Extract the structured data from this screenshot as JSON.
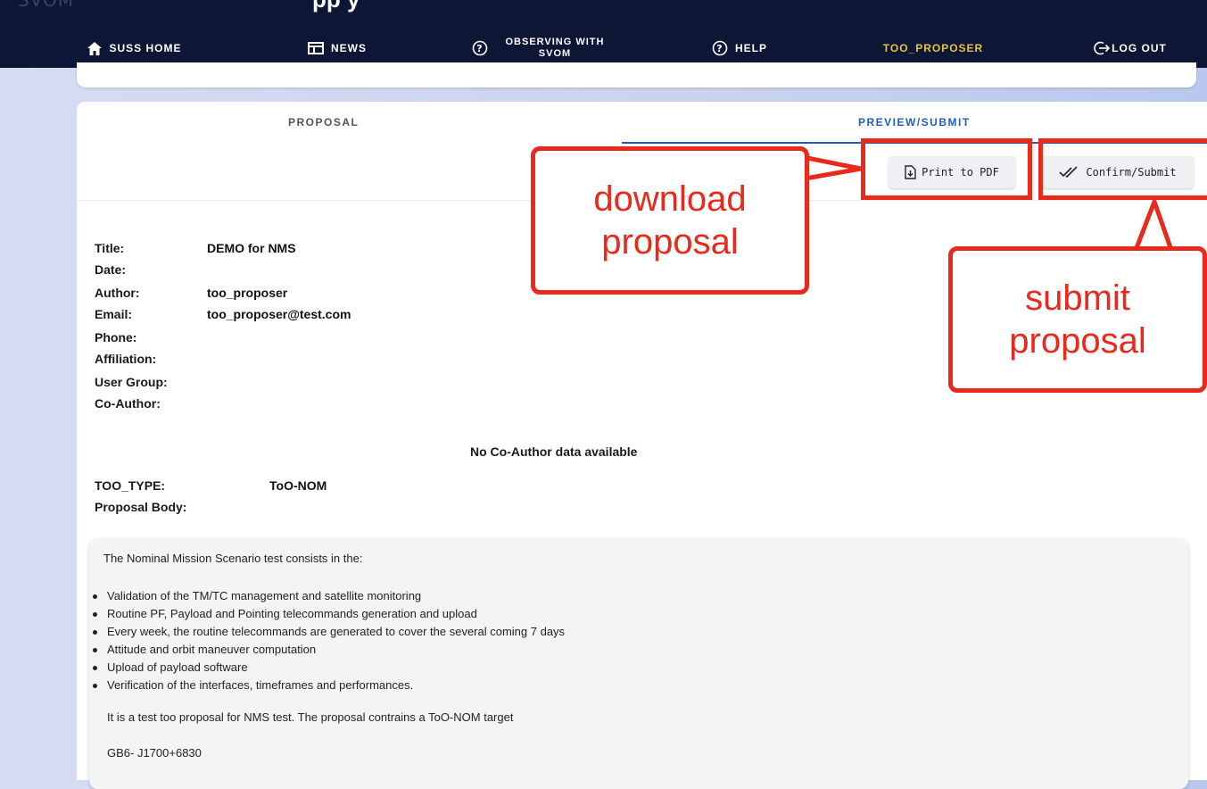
{
  "brand": "SVOM",
  "header_title": "pp y",
  "nav": {
    "home": "SUSS HOME",
    "news": "NEWS",
    "observing_line1": "OBSERVING WITH",
    "observing_line2": "SVOM",
    "help": "HELP",
    "proposer": "TOO_PROPOSER",
    "logout": "LOG OUT"
  },
  "tabs": {
    "proposal": "PROPOSAL",
    "preview": "PREVIEW/SUBMIT"
  },
  "buttons": {
    "print": "Print to PDF",
    "confirm": "Confirm/Submit"
  },
  "info": {
    "title_label": "Title:",
    "title_value": "DEMO for NMS",
    "date_label": "Date:",
    "author_label": "Author:",
    "author_value": "too_proposer",
    "email_label": "Email:",
    "email_value": "too_proposer@test.com",
    "phone_label": "Phone:",
    "affiliation_label": "Affiliation:",
    "usergroup_label": "User Group:",
    "coauthor_label": "Co-Author:",
    "no_coauthor": "No Co-Author data available",
    "tootype_label": "TOO_TYPE:",
    "tootype_value": "ToO-NOM",
    "body_label": "Proposal Body:"
  },
  "body": {
    "intro": "The Nominal Mission Scenario test consists in the:",
    "bullets": [
      "Validation of the TM/TC management and satellite monitoring",
      "Routine PF, Payload and Pointing telecommands generation and upload",
      "Every week, the routine telecommands are generated to cover the several coming 7 days",
      "Attitude and orbit maneuver computation",
      "Upload of payload software",
      "Verification of the interfaces, timeframes and performances."
    ],
    "note": "It is a test too proposal for NMS test. The proposal contrains a ToO-NOM target",
    "target": "GB6- J1700+6830"
  },
  "annotations": {
    "download": "download proposal",
    "submit": "submit proposal"
  },
  "colors": {
    "accent": "#e8c23b",
    "tab_active": "#1f5fbf",
    "annotation": "#e8291c",
    "navbar": "#0d1635"
  }
}
